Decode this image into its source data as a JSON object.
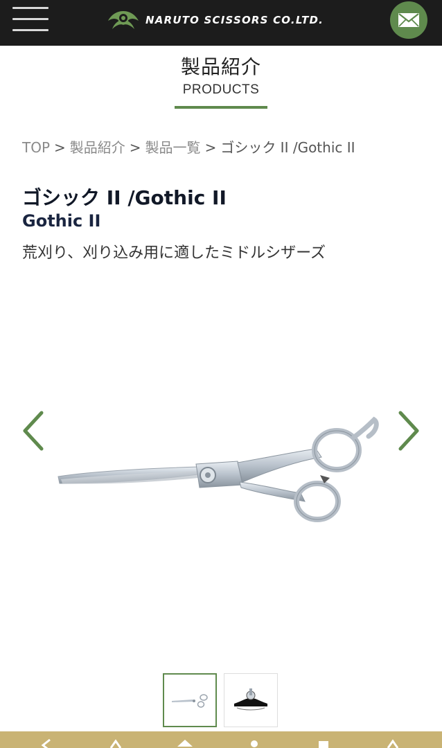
{
  "header": {
    "brand_name": "NARUTO SCISSORS CO.LTD.",
    "accent_color": "#5f8a4d",
    "menu_icon": "hamburger-icon",
    "mail_icon": "mail-icon"
  },
  "section": {
    "title_jp": "製品紹介",
    "title_en": "PRODUCTS"
  },
  "breadcrumb": {
    "items": [
      "TOP",
      "製品紹介",
      "製品一覧"
    ],
    "separator": ">",
    "current": "ゴシック II /Gothic II"
  },
  "product": {
    "title": "ゴシック II /Gothic II",
    "subtitle": "Gothic II",
    "description": "荒刈り、刈り込み用に適したミドルシザーズ"
  },
  "gallery": {
    "prev_icon": "chevron-left-icon",
    "next_icon": "chevron-right-icon",
    "thumbnail_count": 2,
    "active_index": 0
  }
}
